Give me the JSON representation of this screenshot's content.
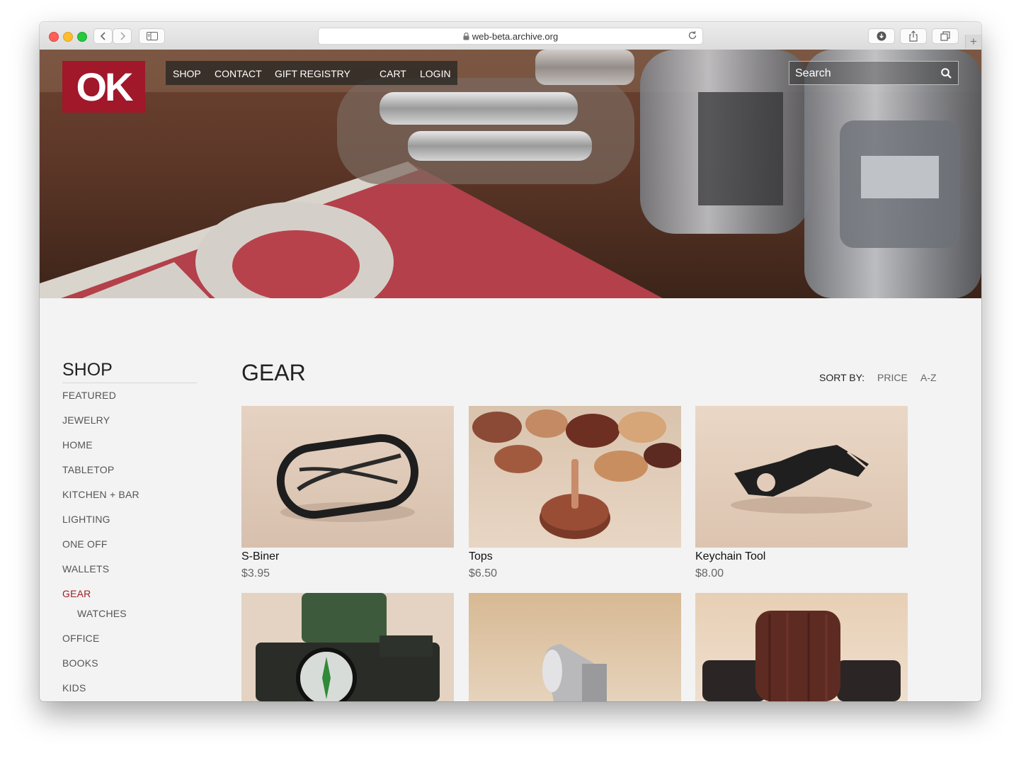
{
  "browser": {
    "url": "web-beta.archive.org"
  },
  "site": {
    "logo_text": "OK",
    "nav": [
      "SHOP",
      "CONTACT",
      "GIFT REGISTRY",
      "CART",
      "LOGIN"
    ],
    "search_placeholder": "Search"
  },
  "sidebar": {
    "title": "SHOP",
    "categories": [
      "FEATURED",
      "JEWELRY",
      "HOME",
      "TABLETOP",
      "KITCHEN + BAR",
      "LIGHTING",
      "ONE OFF",
      "WALLETS",
      "GEAR",
      "WATCHES",
      "OFFICE",
      "BOOKS",
      "KIDS"
    ],
    "active": "GEAR",
    "subcategory": "WATCHES"
  },
  "main": {
    "title": "GEAR",
    "sort_label": "SORT BY:",
    "sort_options": [
      "PRICE",
      "A-Z"
    ]
  },
  "products": [
    {
      "name": "S-Biner",
      "price": "$3.95"
    },
    {
      "name": "Tops",
      "price": "$6.50"
    },
    {
      "name": "Keychain Tool",
      "price": "$8.00"
    }
  ],
  "colors": {
    "accent": "#9e1d25",
    "logo_bg": "#a0182a",
    "page_bg": "#f3f3f3"
  }
}
